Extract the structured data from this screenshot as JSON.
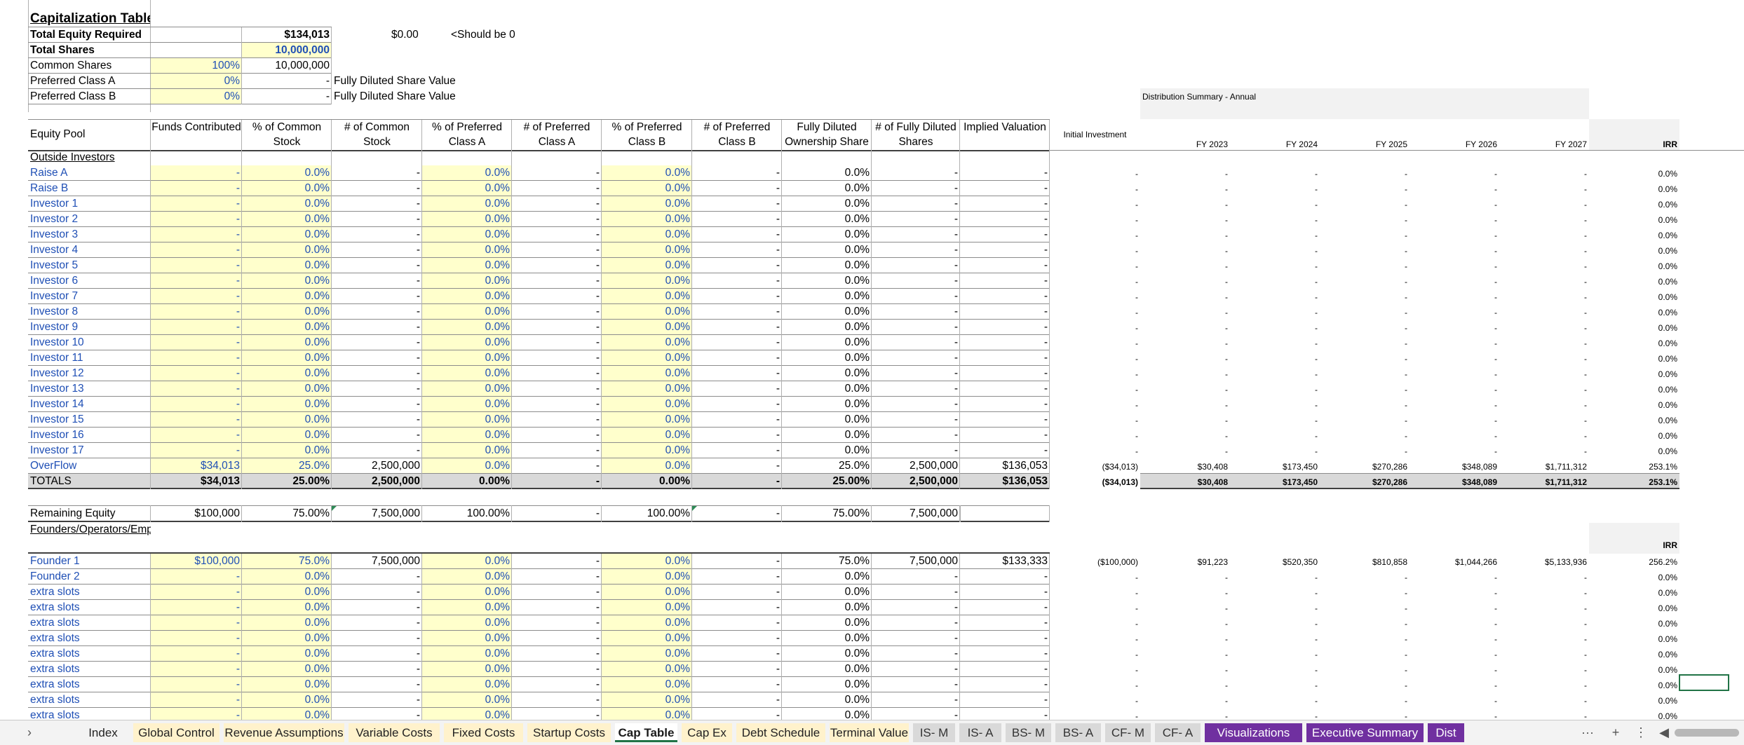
{
  "header": {
    "title": "Capitalization Table",
    "check_value": "$0.00",
    "check_note": "<Should be 0",
    "fully_diluted_label_a": "Fully Diluted Share Value",
    "fully_diluted_label_b": "Fully Diluted Share Value",
    "summary": [
      {
        "label": "Total Equity Required",
        "pct": "",
        "value": "$134,013"
      },
      {
        "label": "Total Shares",
        "pct": "",
        "value": "10,000,000"
      },
      {
        "label": "Common Shares",
        "pct": "100%",
        "value": "10,000,000"
      },
      {
        "label": "Preferred Class A",
        "pct": "0%",
        "value": "-"
      },
      {
        "label": "Preferred Class B",
        "pct": "0%",
        "value": "-"
      }
    ]
  },
  "columns": [
    "Equity Pool",
    "Funds Contributed",
    "% of Common Stock",
    "# of Common Stock",
    "% of Preferred Class A",
    "# of Preferred Class A",
    "% of Preferred Class B",
    "# of Preferred Class B",
    "Fully Diluted Ownership Share",
    "# of Fully Diluted Shares",
    "Implied Valuation"
  ],
  "distribution": {
    "title": "Distribution Summary - Annual",
    "columns": [
      "Initial Investment",
      "FY 2023",
      "FY 2024",
      "FY 2025",
      "FY 2026",
      "FY 2027",
      "IRR"
    ]
  },
  "outside": {
    "label": "Outside Investors",
    "rows": [
      {
        "name": "Raise A",
        "v": [
          "-",
          "0.0%",
          "-",
          "0.0%",
          "-",
          "0.0%",
          "-",
          "0.0%",
          "-",
          "-"
        ],
        "d": [
          "-",
          "-",
          "-",
          "-",
          "-",
          "-",
          "0.0%"
        ]
      },
      {
        "name": "Raise B",
        "v": [
          "-",
          "0.0%",
          "-",
          "0.0%",
          "-",
          "0.0%",
          "-",
          "0.0%",
          "-",
          "-"
        ],
        "d": [
          "-",
          "-",
          "-",
          "-",
          "-",
          "-",
          "0.0%"
        ]
      },
      {
        "name": "Investor 1",
        "v": [
          "-",
          "0.0%",
          "-",
          "0.0%",
          "-",
          "0.0%",
          "-",
          "0.0%",
          "-",
          "-"
        ],
        "d": [
          "-",
          "-",
          "-",
          "-",
          "-",
          "-",
          "0.0%"
        ]
      },
      {
        "name": "Investor 2",
        "v": [
          "-",
          "0.0%",
          "-",
          "0.0%",
          "-",
          "0.0%",
          "-",
          "0.0%",
          "-",
          "-"
        ],
        "d": [
          "-",
          "-",
          "-",
          "-",
          "-",
          "-",
          "0.0%"
        ]
      },
      {
        "name": "Investor 3",
        "v": [
          "-",
          "0.0%",
          "-",
          "0.0%",
          "-",
          "0.0%",
          "-",
          "0.0%",
          "-",
          "-"
        ],
        "d": [
          "-",
          "-",
          "-",
          "-",
          "-",
          "-",
          "0.0%"
        ]
      },
      {
        "name": "Investor 4",
        "v": [
          "-",
          "0.0%",
          "-",
          "0.0%",
          "-",
          "0.0%",
          "-",
          "0.0%",
          "-",
          "-"
        ],
        "d": [
          "-",
          "-",
          "-",
          "-",
          "-",
          "-",
          "0.0%"
        ]
      },
      {
        "name": "Investor 5",
        "v": [
          "-",
          "0.0%",
          "-",
          "0.0%",
          "-",
          "0.0%",
          "-",
          "0.0%",
          "-",
          "-"
        ],
        "d": [
          "-",
          "-",
          "-",
          "-",
          "-",
          "-",
          "0.0%"
        ]
      },
      {
        "name": "Investor 6",
        "v": [
          "-",
          "0.0%",
          "-",
          "0.0%",
          "-",
          "0.0%",
          "-",
          "0.0%",
          "-",
          "-"
        ],
        "d": [
          "-",
          "-",
          "-",
          "-",
          "-",
          "-",
          "0.0%"
        ]
      },
      {
        "name": "Investor 7",
        "v": [
          "-",
          "0.0%",
          "-",
          "0.0%",
          "-",
          "0.0%",
          "-",
          "0.0%",
          "-",
          "-"
        ],
        "d": [
          "-",
          "-",
          "-",
          "-",
          "-",
          "-",
          "0.0%"
        ]
      },
      {
        "name": "Investor 8",
        "v": [
          "-",
          "0.0%",
          "-",
          "0.0%",
          "-",
          "0.0%",
          "-",
          "0.0%",
          "-",
          "-"
        ],
        "d": [
          "-",
          "-",
          "-",
          "-",
          "-",
          "-",
          "0.0%"
        ]
      },
      {
        "name": "Investor 9",
        "v": [
          "-",
          "0.0%",
          "-",
          "0.0%",
          "-",
          "0.0%",
          "-",
          "0.0%",
          "-",
          "-"
        ],
        "d": [
          "-",
          "-",
          "-",
          "-",
          "-",
          "-",
          "0.0%"
        ]
      },
      {
        "name": "Investor 10",
        "v": [
          "-",
          "0.0%",
          "-",
          "0.0%",
          "-",
          "0.0%",
          "-",
          "0.0%",
          "-",
          "-"
        ],
        "d": [
          "-",
          "-",
          "-",
          "-",
          "-",
          "-",
          "0.0%"
        ]
      },
      {
        "name": "Investor 11",
        "v": [
          "-",
          "0.0%",
          "-",
          "0.0%",
          "-",
          "0.0%",
          "-",
          "0.0%",
          "-",
          "-"
        ],
        "d": [
          "-",
          "-",
          "-",
          "-",
          "-",
          "-",
          "0.0%"
        ]
      },
      {
        "name": "Investor 12",
        "v": [
          "-",
          "0.0%",
          "-",
          "0.0%",
          "-",
          "0.0%",
          "-",
          "0.0%",
          "-",
          "-"
        ],
        "d": [
          "-",
          "-",
          "-",
          "-",
          "-",
          "-",
          "0.0%"
        ]
      },
      {
        "name": "Investor 13",
        "v": [
          "-",
          "0.0%",
          "-",
          "0.0%",
          "-",
          "0.0%",
          "-",
          "0.0%",
          "-",
          "-"
        ],
        "d": [
          "-",
          "-",
          "-",
          "-",
          "-",
          "-",
          "0.0%"
        ]
      },
      {
        "name": "Investor 14",
        "v": [
          "-",
          "0.0%",
          "-",
          "0.0%",
          "-",
          "0.0%",
          "-",
          "0.0%",
          "-",
          "-"
        ],
        "d": [
          "-",
          "-",
          "-",
          "-",
          "-",
          "-",
          "0.0%"
        ]
      },
      {
        "name": "Investor 15",
        "v": [
          "-",
          "0.0%",
          "-",
          "0.0%",
          "-",
          "0.0%",
          "-",
          "0.0%",
          "-",
          "-"
        ],
        "d": [
          "-",
          "-",
          "-",
          "-",
          "-",
          "-",
          "0.0%"
        ]
      },
      {
        "name": "Investor 16",
        "v": [
          "-",
          "0.0%",
          "-",
          "0.0%",
          "-",
          "0.0%",
          "-",
          "0.0%",
          "-",
          "-"
        ],
        "d": [
          "-",
          "-",
          "-",
          "-",
          "-",
          "-",
          "0.0%"
        ]
      },
      {
        "name": "Investor 17",
        "v": [
          "-",
          "0.0%",
          "-",
          "0.0%",
          "-",
          "0.0%",
          "-",
          "0.0%",
          "-",
          "-"
        ],
        "d": [
          "-",
          "-",
          "-",
          "-",
          "-",
          "-",
          "0.0%"
        ]
      },
      {
        "name": "OverFlow",
        "v": [
          "$34,013",
          "25.0%",
          "2,500,000",
          "0.0%",
          "-",
          "0.0%",
          "-",
          "25.0%",
          "2,500,000",
          "$136,053"
        ],
        "d": [
          "($34,013)",
          "$30,408",
          "$173,450",
          "$270,286",
          "$348,089",
          "$1,711,312",
          "253.1%"
        ]
      }
    ],
    "totals": {
      "name": "TOTALS",
      "v": [
        "$34,013",
        "25.00%",
        "2,500,000",
        "0.00%",
        "-",
        "0.00%",
        "-",
        "25.00%",
        "2,500,000",
        "$136,053"
      ],
      "d": [
        "($34,013)",
        "$30,408",
        "$173,450",
        "$270,286",
        "$348,089",
        "$1,711,312",
        "253.1%"
      ]
    }
  },
  "remaining": {
    "name": "Remaining Equity",
    "v": [
      "$100,000",
      "75.00%",
      "7,500,000",
      "100.00%",
      "-",
      "100.00%",
      "-",
      "75.00%",
      "7,500,000",
      ""
    ]
  },
  "founders": {
    "label": "Founders/Operators/Employees",
    "irr_label": "IRR",
    "rows": [
      {
        "name": "Founder 1",
        "v": [
          "$100,000",
          "75.0%",
          "7,500,000",
          "0.0%",
          "-",
          "0.0%",
          "-",
          "75.0%",
          "7,500,000",
          "$133,333"
        ],
        "d": [
          "($100,000)",
          "$91,223",
          "$520,350",
          "$810,858",
          "$1,044,266",
          "$5,133,936",
          "256.2%"
        ]
      },
      {
        "name": "Founder 2",
        "v": [
          "-",
          "0.0%",
          "-",
          "0.0%",
          "-",
          "0.0%",
          "-",
          "0.0%",
          "-",
          "-"
        ],
        "d": [
          "-",
          "-",
          "-",
          "-",
          "-",
          "-",
          "0.0%"
        ]
      },
      {
        "name": "extra slots",
        "v": [
          "-",
          "0.0%",
          "-",
          "0.0%",
          "-",
          "0.0%",
          "-",
          "0.0%",
          "-",
          "-"
        ],
        "d": [
          "-",
          "-",
          "-",
          "-",
          "-",
          "-",
          "0.0%"
        ]
      },
      {
        "name": "extra slots",
        "v": [
          "-",
          "0.0%",
          "-",
          "0.0%",
          "-",
          "0.0%",
          "-",
          "0.0%",
          "-",
          "-"
        ],
        "d": [
          "-",
          "-",
          "-",
          "-",
          "-",
          "-",
          "0.0%"
        ]
      },
      {
        "name": "extra slots",
        "v": [
          "-",
          "0.0%",
          "-",
          "0.0%",
          "-",
          "0.0%",
          "-",
          "0.0%",
          "-",
          "-"
        ],
        "d": [
          "-",
          "-",
          "-",
          "-",
          "-",
          "-",
          "0.0%"
        ]
      },
      {
        "name": "extra slots",
        "v": [
          "-",
          "0.0%",
          "-",
          "0.0%",
          "-",
          "0.0%",
          "-",
          "0.0%",
          "-",
          "-"
        ],
        "d": [
          "-",
          "-",
          "-",
          "-",
          "-",
          "-",
          "0.0%"
        ]
      },
      {
        "name": "extra slots",
        "v": [
          "-",
          "0.0%",
          "-",
          "0.0%",
          "-",
          "0.0%",
          "-",
          "0.0%",
          "-",
          "-"
        ],
        "d": [
          "-",
          "-",
          "-",
          "-",
          "-",
          "-",
          "0.0%"
        ]
      },
      {
        "name": "extra slots",
        "v": [
          "-",
          "0.0%",
          "-",
          "0.0%",
          "-",
          "0.0%",
          "-",
          "0.0%",
          "-",
          "-"
        ],
        "d": [
          "-",
          "-",
          "-",
          "-",
          "-",
          "-",
          "0.0%"
        ]
      },
      {
        "name": "extra slots",
        "v": [
          "-",
          "0.0%",
          "-",
          "0.0%",
          "-",
          "0.0%",
          "-",
          "0.0%",
          "-",
          "-"
        ],
        "d": [
          "-",
          "-",
          "-",
          "-",
          "-",
          "-",
          "0.0%"
        ]
      },
      {
        "name": "extra slots",
        "v": [
          "-",
          "0.0%",
          "-",
          "0.0%",
          "-",
          "0.0%",
          "-",
          "0.0%",
          "-",
          "-"
        ],
        "d": [
          "-",
          "-",
          "-",
          "-",
          "-",
          "-",
          "0.0%"
        ]
      },
      {
        "name": "extra slots",
        "v": [
          "-",
          "0.0%",
          "-",
          "0.0%",
          "-",
          "0.0%",
          "-",
          "0.0%",
          "-",
          "-"
        ],
        "d": [
          "-",
          "-",
          "-",
          "-",
          "-",
          "-",
          "0.0%"
        ]
      }
    ]
  },
  "tabs": [
    {
      "label": "Index",
      "style": "w"
    },
    {
      "label": "Global Control",
      "style": "y"
    },
    {
      "label": "Revenue Assumptions",
      "style": "y"
    },
    {
      "label": "Variable Costs",
      "style": "y"
    },
    {
      "label": "Fixed Costs",
      "style": "y"
    },
    {
      "label": "Startup Costs",
      "style": "y"
    },
    {
      "label": "Cap Table",
      "style": "a"
    },
    {
      "label": "Cap Ex",
      "style": "y"
    },
    {
      "label": "Debt Schedule",
      "style": "y"
    },
    {
      "label": "Terminal Value",
      "style": "y"
    },
    {
      "label": "IS- M",
      "style": "g"
    },
    {
      "label": "IS- A",
      "style": "g"
    },
    {
      "label": "BS- M",
      "style": "g"
    },
    {
      "label": "BS- A",
      "style": "g"
    },
    {
      "label": "CF- M",
      "style": "g"
    },
    {
      "label": "CF- A",
      "style": "g"
    },
    {
      "label": "Visualizations",
      "style": "p"
    },
    {
      "label": "Executive Summary",
      "style": "p"
    },
    {
      "label": "Dist",
      "style": "p"
    }
  ],
  "tabbar_controls": {
    "prev": "›",
    "more": "···",
    "add": "+",
    "menu": "⋮",
    "scroll_left": "◀"
  },
  "colors": {
    "input_yellow": "#ffffcc",
    "total_gray": "#d9d9d9",
    "link_blue": "#1f4fb5",
    "purple_tab": "#7030a0",
    "excel_green": "#217346"
  }
}
